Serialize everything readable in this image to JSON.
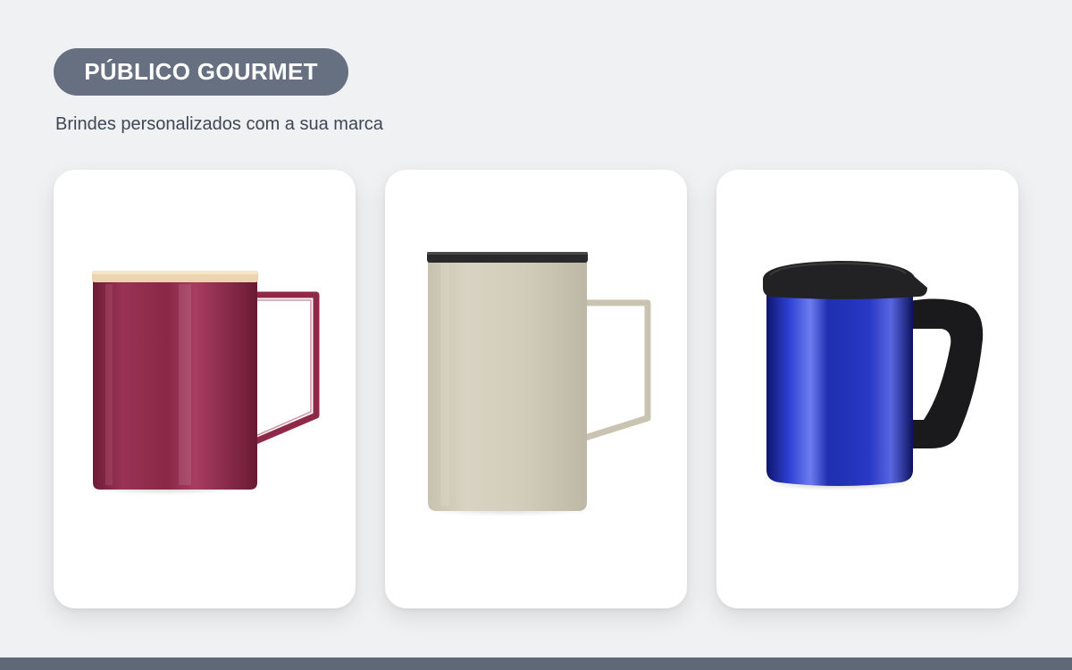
{
  "header": {
    "badge_label": "PÚBLICO GOURMET",
    "subtitle": "Brindes personalizados com a sua marca"
  },
  "colors": {
    "page_background": "#f0f1f3",
    "badge_background": "#667080",
    "subtitle_text": "#3d4756",
    "card_background": "#ffffff",
    "footer_bar": "#5f6876"
  },
  "products": [
    {
      "image": "maroon-mug-with-bamboo-lid",
      "color": "#8e2a48"
    },
    {
      "image": "beige-mug-with-black-lid",
      "color": "#d3cdbd"
    },
    {
      "image": "blue-steel-mug-with-black-lid",
      "color": "#1f2fa8"
    }
  ]
}
